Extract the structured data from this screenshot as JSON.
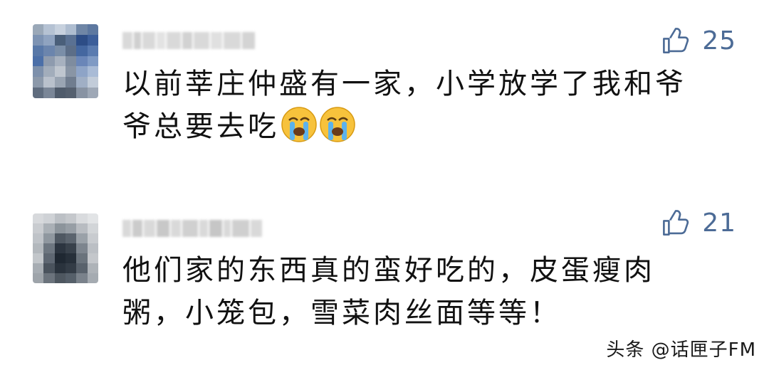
{
  "comments": [
    {
      "like_count": "25",
      "text": "以前莘庄仲盛有一家，小学放学了我和爷\n爷总要去吃",
      "emojis": [
        "crying-face",
        "crying-face"
      ]
    },
    {
      "like_count": "21",
      "text": "他们家的东西真的蛮好吃的，皮蛋瘦肉\n粥，小笼包，雪菜肉丝面等等！"
    }
  ],
  "watermark": "头条 @话匣子FM",
  "colors": {
    "like_icon": "#4c6b96",
    "text": "#111111",
    "background": "#ffffff"
  }
}
